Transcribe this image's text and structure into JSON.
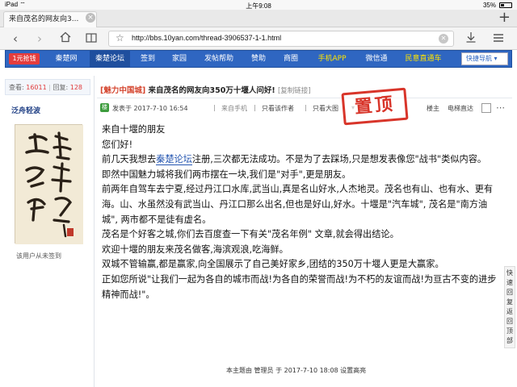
{
  "status_bar": {
    "time": "上午9:08",
    "battery": "35%"
  },
  "browser": {
    "tab_title": "来自茂名的网友向3...",
    "tab_close": "×",
    "new_tab": "+",
    "url": "http://bbs.10yan.com/thread-3906537-1-1.html"
  },
  "nav": {
    "items": [
      {
        "label": "1元抢钱"
      },
      {
        "label": "秦楚网"
      },
      {
        "label": "秦楚论坛"
      },
      {
        "label": "签到"
      },
      {
        "label": "家园"
      },
      {
        "label": "发帖帮助"
      },
      {
        "label": "赞助"
      },
      {
        "label": "商圈"
      },
      {
        "label": "手机APP"
      },
      {
        "label": "微信通"
      },
      {
        "label": "民意直通车"
      }
    ],
    "quick_nav": "快捷导航"
  },
  "sidebar": {
    "views_label": "查看:",
    "views": "16011",
    "replies_label": "回复:",
    "replies": "128",
    "username": "泛舟轻波",
    "no_signature": "该用户从未签到"
  },
  "post": {
    "category": "[魅力中国城]",
    "title": "来自茂名的网友向350万十堰人问好!",
    "copy_link": "[复制链接]",
    "op_badge": "楼",
    "posted": "发表于 2017-7-10 16:54",
    "from_mobile": "来自手机",
    "only_author": "只看该作者",
    "only_large": "只看大图",
    "floor": "楼主",
    "elevator": "电梯直达",
    "stamp": "置顶",
    "lines": [
      "来自十堰的朋友",
      "您们好!",
      "前几天我想去",
      "秦楚论坛",
      "注册,三次都无法成功。不是为了去踩场,只是想发表像您\"战书\"类似内容。",
      "即然中国魅力城将我们两市摆在一块,我们是\"对手\",更是朋友。",
      "前两年自驾车去宁夏,经过丹江口水库,武当山,真是名山好水,人杰地灵。茂名也有山、也有水、更有海。山、水虽然没有武当山、丹江口那么出名,但也是好山,好水。十堰是\"汽车城\", 茂名是\"南方油城\", 两市都不是徒有虚名。",
      "茂名是个好客之城,你们去百度查一下有关\"茂名年例\" 文章,就会得出结论。",
      "欢迎十堰的朋友来茂名做客,海滨观浪,吃海鲜。",
      "双城不管输赢,都是赢家,向全国展示了自己美好家乡,团结的350万十堰人更是大赢家。",
      "正如您所说\"让我们一起为各自的城市而战!为各自的荣誉而战!为不朽的友谊而战!为亘古不变的进步精神而战!\"。"
    ],
    "edit_note": "本主题由 管理员 于 2017-7-10 18:08 设置高亮"
  },
  "quick_reply": "快速回复返回顶部"
}
